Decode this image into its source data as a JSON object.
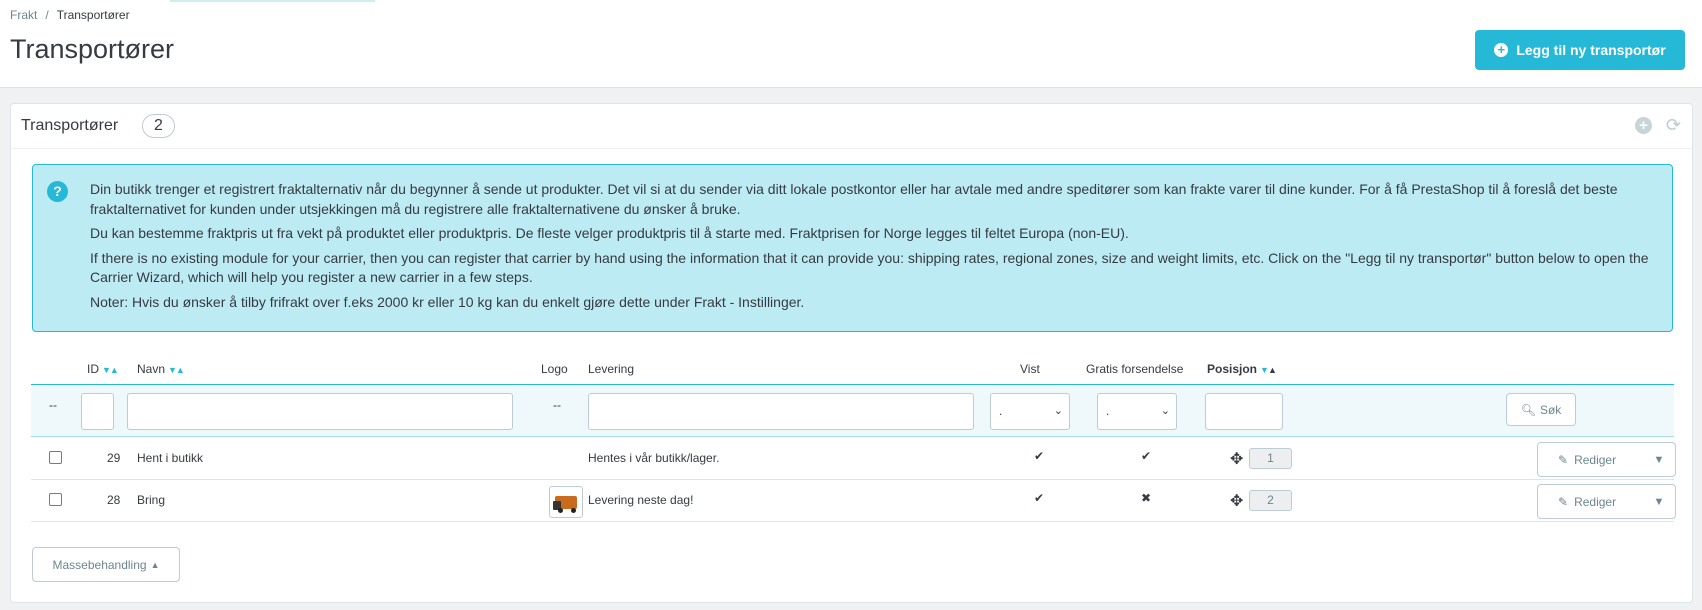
{
  "breadcrumb": {
    "parent": "Frakt",
    "separator": "/",
    "current": "Transportører"
  },
  "page": {
    "title": "Transportører",
    "add_button": "Legg til ny transportør"
  },
  "panel": {
    "title": "Transportører",
    "count": "2",
    "alert": {
      "paragraphs": [
        "Din butikk trenger et registrert fraktalternativ når du begynner å sende ut produkter. Det vil si at du sender via ditt lokale postkontor eller har avtale med andre speditører som kan frakte varer til dine kunder. For å få PrestaShop til å foreslå det beste fraktalternativet for kunden under utsjekkingen må du registrere alle fraktalternativene du ønsker å bruke.",
        "Du kan bestemme fraktpris ut fra vekt på produktet eller produktpris. De fleste velger produktpris til å starte med. Fraktprisen for Norge legges til feltet Europa (non-EU).",
        "If there is no existing module for your carrier, then you can register that carrier by hand using the information that it can provide you: shipping rates, regional zones, size and weight limits, etc. Click on the \"Legg til ny transportør\" button below to open the Carrier Wizard, which will help you register a new carrier in a few steps.",
        "Noter: Hvis du ønsker å tilby frifrakt over f.eks 2000 kr eller 10 kg kan du enkelt gjøre dette under Frakt - Instillinger."
      ]
    }
  },
  "table": {
    "columns": {
      "id": "ID",
      "name": "Navn",
      "logo": "Logo",
      "delivery": "Levering",
      "shown": "Vist",
      "free": "Gratis forsendelse",
      "position": "Posisjon"
    },
    "filters": {
      "dash": "--",
      "select_value": ".",
      "search_button": "Søk"
    },
    "rows": [
      {
        "id": "29",
        "name": "Hent i butikk",
        "delivery": "Hentes i vår butikk/lager.",
        "shown": "✔",
        "free": "✔",
        "position": "1",
        "edit": "Rediger",
        "has_logo": false
      },
      {
        "id": "28",
        "name": "Bring",
        "delivery": "Levering neste dag!",
        "shown": "✔",
        "free": "✖",
        "position": "2",
        "edit": "Rediger",
        "has_logo": true
      }
    ],
    "bulk_button": "Massebehandling"
  },
  "colors": {
    "accent": "#25b9d7",
    "success": "#70b580",
    "danger": "#e08f95"
  }
}
